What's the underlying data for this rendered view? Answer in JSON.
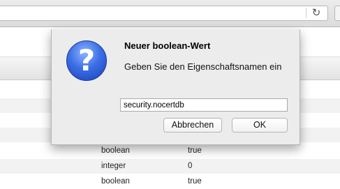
{
  "toolbar": {
    "reload_icon": "reload-icon"
  },
  "table": {
    "rows": [
      {
        "type": "",
        "value": ""
      },
      {
        "type": "",
        "value": ""
      },
      {
        "type": "",
        "value": ""
      },
      {
        "type": "",
        "value": ""
      },
      {
        "type": "boolean",
        "value": "true"
      },
      {
        "type": "integer",
        "value": "0"
      },
      {
        "type": "boolean",
        "value": "true"
      }
    ]
  },
  "dialog": {
    "title": "Neuer boolean-Wert",
    "message": "Geben Sie den Eigenschaftsnamen ein",
    "input_value": "security.nocertdb",
    "cancel_label": "Abbrechen",
    "ok_label": "OK",
    "icon": "question-icon"
  },
  "colors": {
    "dialog_bg": "#ececec",
    "icon_blue": "#3b6fe6"
  }
}
